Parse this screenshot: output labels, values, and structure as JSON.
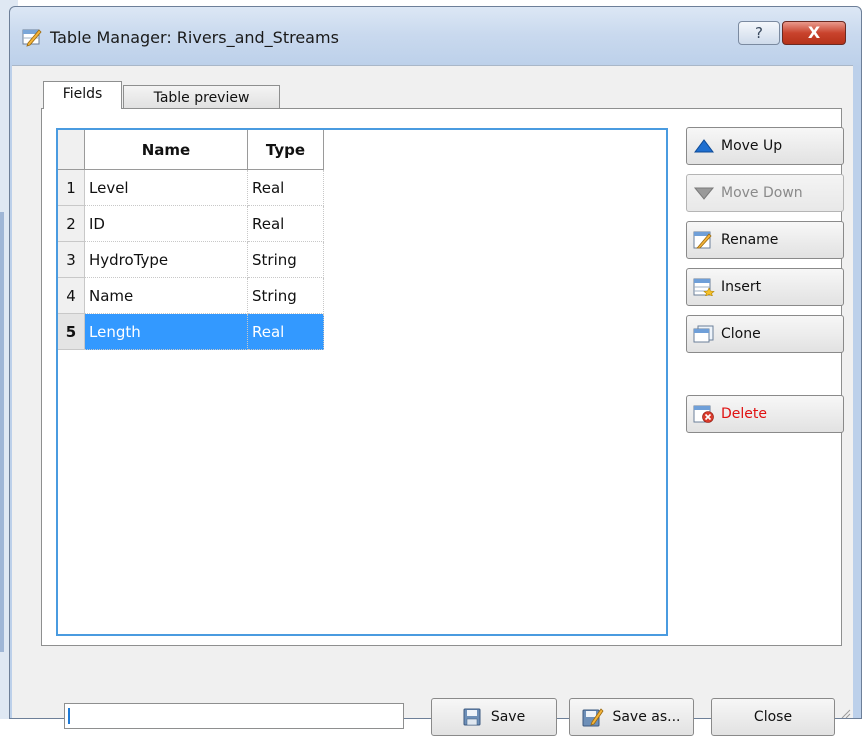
{
  "window": {
    "title": "Table Manager: Rivers_and_Streams",
    "help_label": "?",
    "close_label": "X"
  },
  "tabs": [
    {
      "label": "Fields",
      "active": true
    },
    {
      "label": "Table preview",
      "active": false
    }
  ],
  "table": {
    "columns": [
      "Name",
      "Type"
    ],
    "rows": [
      {
        "num": "1",
        "name": "Level",
        "type": "Real"
      },
      {
        "num": "2",
        "name": "ID",
        "type": "Real"
      },
      {
        "num": "3",
        "name": "HydroType",
        "type": "String"
      },
      {
        "num": "4",
        "name": "Name",
        "type": "String"
      },
      {
        "num": "5",
        "name": "Length",
        "type": "Real",
        "selected": true
      }
    ]
  },
  "side_buttons": {
    "move_up": "Move Up",
    "move_down": "Move Down",
    "rename": "Rename",
    "insert": "Insert",
    "clone": "Clone",
    "delete": "Delete"
  },
  "bottom": {
    "status_value": "",
    "save": "Save",
    "save_as": "Save as...",
    "close": "Close"
  },
  "colors": {
    "selection": "#3399ff",
    "focus_border": "#4a9be0",
    "delete_text": "#e01010"
  },
  "icons": [
    "table-edit-icon",
    "arrow-up-icon",
    "arrow-down-icon",
    "rename-icon",
    "insert-icon",
    "clone-icon",
    "delete-icon",
    "floppy-disk-icon",
    "save-as-icon"
  ]
}
